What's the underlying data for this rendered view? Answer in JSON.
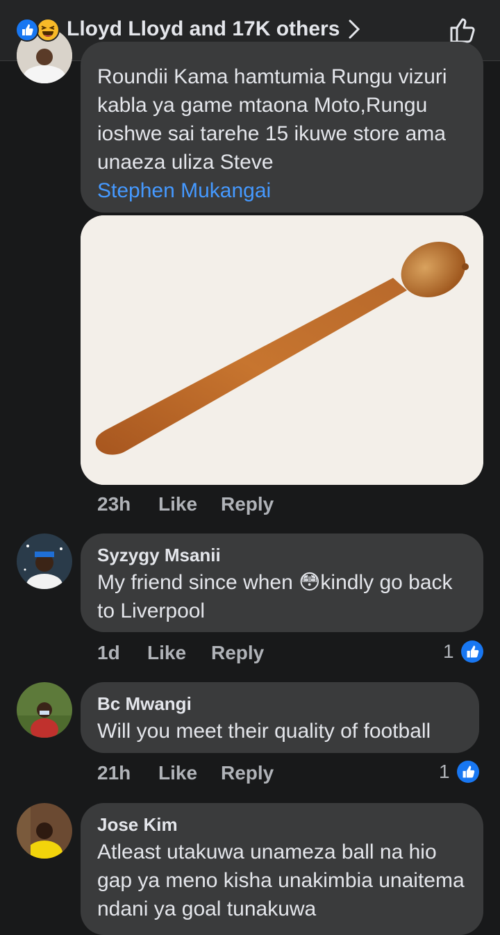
{
  "header": {
    "title": "Lloyd Lloyd and 17K others",
    "reaction_icons": [
      "like-reaction-icon",
      "haha-reaction-icon"
    ],
    "accent": "#1877f2"
  },
  "comments": [
    {
      "name": "",
      "text": "Roundii Kama hamtumia Rungu vizuri kabla ya game mtaona Moto,Rungu ioshwe sai tarehe 15 ikuwe store ama unaeza uliza Steve",
      "mention": "Stephen Mukangai",
      "time": "23h",
      "like_label": "Like",
      "reply_label": "Reply"
    },
    {
      "name": "Syzygy Msanii",
      "text_before": "My friend since when ",
      "emoji": "😳",
      "text_after": "kindly go back to Liverpool",
      "time": "1d",
      "like_label": "Like",
      "reply_label": "Reply",
      "reaction_count": "1"
    },
    {
      "name": "Bc Mwangi",
      "text": "Will you meet their quality of football",
      "time": "21h",
      "like_label": "Like",
      "reply_label": "Reply",
      "reaction_count": "1"
    },
    {
      "name": "Jose Kim",
      "text": "Atleast utakuwa unameza ball na hio gap ya meno kisha unakimbia unaitema ndani ya goal tunakuwa"
    }
  ],
  "colors": {
    "background": "#18191a",
    "bubble": "#3a3b3c",
    "meta_text": "#b0b3b8",
    "link": "#4599ff"
  }
}
